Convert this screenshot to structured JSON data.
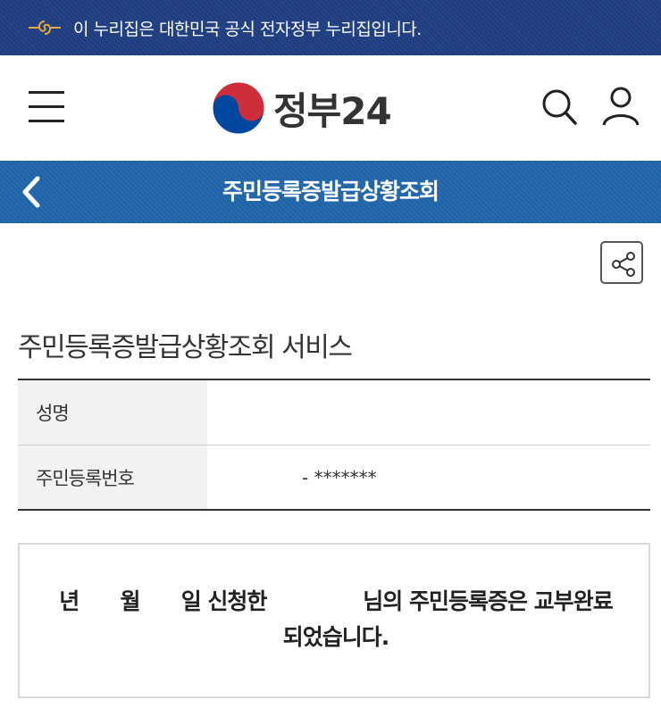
{
  "gov_banner": {
    "text": "이 누리집은 대한민국 공식 전자정부 누리집입니다."
  },
  "header": {
    "logo_text": "정부24"
  },
  "title_bar": {
    "title": "주민등록증발급상황조회"
  },
  "main": {
    "section_title": "주민등록증발급상황조회 서비스",
    "table": [
      {
        "label": "성명",
        "value": ""
      },
      {
        "label": "주민등록번호",
        "value": "- *******"
      }
    ],
    "result": {
      "line1": "년      월      일 신청한              님의 주민등록증은 교부완료",
      "line2": "되었습니다."
    }
  },
  "colors": {
    "banner_bg": "#1d3d80",
    "title_bar_bg": "#1e63a8",
    "emblem_red": "#cd2e3a",
    "emblem_blue": "#0047a0"
  }
}
